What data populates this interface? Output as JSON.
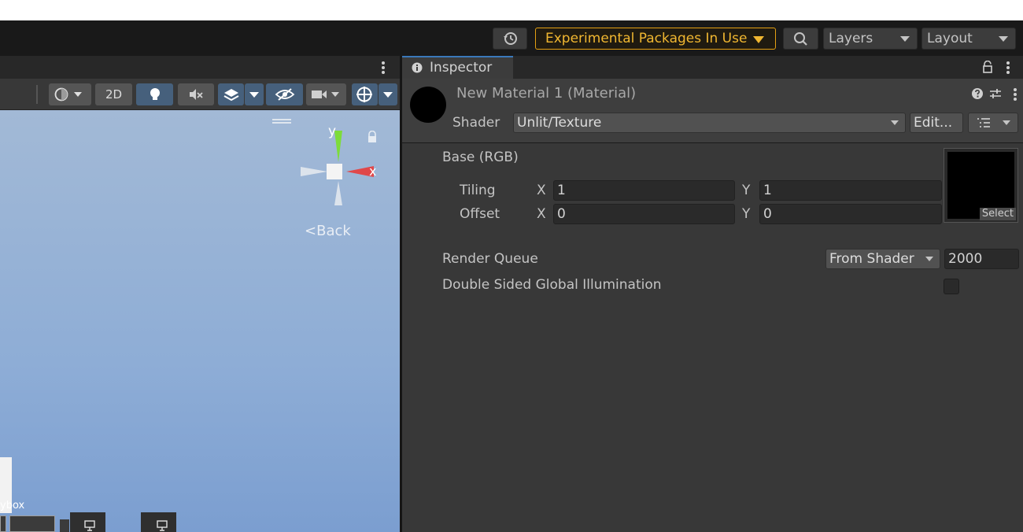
{
  "toolbar": {
    "experimental_label": "Experimental Packages In Use",
    "layers_label": "Layers",
    "layout_label": "Layout",
    "history_icon": "history-icon",
    "search_icon": "search-icon"
  },
  "scene": {
    "toolbar": {
      "mode_2d_label": "2D"
    },
    "gizmo": {
      "y_label": "y",
      "x_label": "x",
      "view_label": "Back",
      "view_arrow": "<"
    },
    "partial_label": "ybox"
  },
  "inspector": {
    "tab_label": "Inspector",
    "material_title": "New Material 1 (Material)",
    "shader_label": "Shader",
    "shader_value": "Unlit/Texture",
    "edit_label": "Edit...",
    "base_label": "Base (RGB)",
    "tiling_label": "Tiling",
    "offset_label": "Offset",
    "tiling_x_label": "X",
    "tiling_x_value": "1",
    "tiling_y_label": "Y",
    "tiling_y_value": "1",
    "offset_x_label": "X",
    "offset_x_value": "0",
    "offset_y_label": "Y",
    "offset_y_value": "0",
    "select_label": "Select",
    "render_queue_label": "Render Queue",
    "render_queue_option": "From Shader",
    "render_queue_value": "2000",
    "dsgi_label": "Double Sided Global Illumination",
    "dsgi_checked": false
  },
  "colors": {
    "accent_blue": "#3a79bb",
    "experimental_border": "#e4a013",
    "experimental_text": "#f1b731",
    "sky_top": "#a2b9d6",
    "sky_bottom": "#7b9ed0",
    "gizmo_x": "#e0484a",
    "gizmo_y": "#7ddc3a"
  }
}
